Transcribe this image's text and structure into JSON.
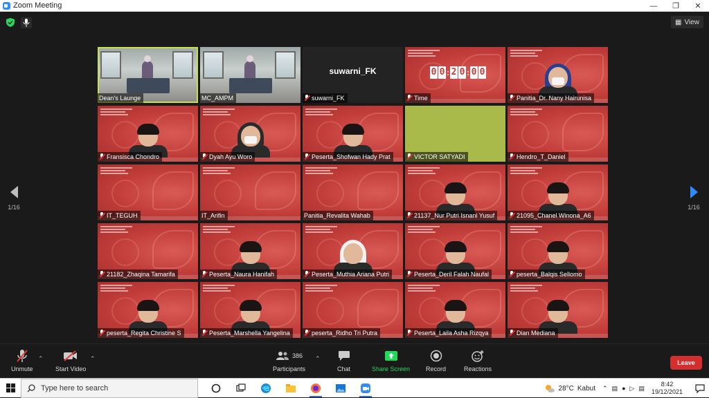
{
  "window": {
    "title": "Zoom Meeting",
    "controls": [
      "minimize-icon",
      "restore-icon",
      "close-icon"
    ]
  },
  "top": {
    "view_label": "View"
  },
  "tiles": [
    {
      "name": "Dean's Launge",
      "type": "lounge",
      "active": true,
      "muted": false
    },
    {
      "name": "MC_AMPM",
      "type": "lounge",
      "muted": false
    },
    {
      "name": "suwarni_FK",
      "type": "dark",
      "big": "suwarni_FK",
      "muted": true
    },
    {
      "name": "Time",
      "type": "timer",
      "timer": [
        "0",
        "0",
        "2",
        "0",
        "0",
        "0"
      ],
      "muted": true
    },
    {
      "name": "Panitia_Dr. Nany Hairunisa",
      "type": "red",
      "person": "hijab-mask",
      "muted": true
    },
    {
      "name": "Fransisca Chondro",
      "type": "red",
      "person": "plain",
      "muted": true
    },
    {
      "name": "Dyah Ayu Woro",
      "type": "red",
      "person": "hijab-mask-dark",
      "muted": true
    },
    {
      "name": "Peserta_Shofwan Hady Prat",
      "type": "red",
      "person": "plain",
      "muted": true
    },
    {
      "name": "VICTOR SATYADI",
      "type": "green",
      "muted": true
    },
    {
      "name": "Hendro_T_Daniel",
      "type": "red",
      "muted": true
    },
    {
      "name": "IT_TEGUH",
      "type": "red",
      "muted": true
    },
    {
      "name": "IT_Arifin",
      "type": "red",
      "muted": false
    },
    {
      "name": "Panitia_Revalita Wahab",
      "type": "red",
      "muted": false
    },
    {
      "name": "21137_Nur Putri Isnani Yusuf",
      "type": "red",
      "person": "plain",
      "muted": true
    },
    {
      "name": "21095_Chanel Winona_A6",
      "type": "red",
      "person": "plain",
      "muted": true
    },
    {
      "name": "21182_Zhaqina Tamarifa",
      "type": "red",
      "muted": true
    },
    {
      "name": "Peserta_Naura Hanifah",
      "type": "red",
      "person": "plain",
      "muted": true
    },
    {
      "name": "Peserta_Muthia Ariana Putri",
      "type": "red",
      "person": "hijab-white",
      "muted": true
    },
    {
      "name": "Peserta_Deril Falah Naufal",
      "type": "red",
      "person": "plain",
      "muted": true
    },
    {
      "name": "peserta_Balqis Sellomo",
      "type": "red",
      "person": "plain",
      "muted": true
    },
    {
      "name": "peserta_Regita Christine S",
      "type": "red",
      "person": "plain",
      "muted": true
    },
    {
      "name": "Peserta_Marshella Yangelina",
      "type": "red",
      "person": "plain",
      "muted": true
    },
    {
      "name": "peserta_Ridho Tri Putra",
      "type": "red",
      "muted": true
    },
    {
      "name": "Peserta_Laila Asha Rizqya",
      "type": "red",
      "person": "plain",
      "muted": true
    },
    {
      "name": "Dian Mediana",
      "type": "red",
      "person": "plain",
      "muted": true
    }
  ],
  "nav": {
    "left_page": "1/16",
    "right_page": "1/16"
  },
  "toolbar": {
    "unmute": "Unmute",
    "start_video": "Start Video",
    "participants": "Participants",
    "participants_count": "386",
    "chat": "Chat",
    "share_screen": "Share Screen",
    "record": "Record",
    "reactions": "Reactions",
    "leave": "Leave"
  },
  "taskbar": {
    "search_placeholder": "Type here to search",
    "weather_temp": "28°C",
    "weather_desc": "Kabut",
    "time": "8:42",
    "date": "19/12/2021",
    "apps": [
      "task-view-icon",
      "cortana-icon",
      "edge-icon",
      "file-explorer-icon",
      "firefox-icon",
      "photos-icon",
      "zoom-icon"
    ]
  },
  "colors": {
    "accent": "#2d8cff",
    "share_green": "#23d959",
    "leave_red": "#d32f2f",
    "active_speaker": "#c6e24a"
  }
}
